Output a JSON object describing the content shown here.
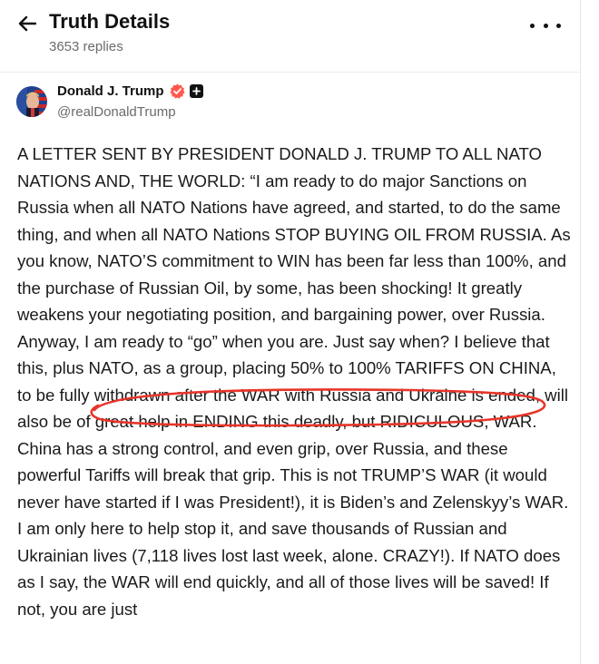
{
  "header": {
    "title": "Truth Details",
    "subtitle": "3653 replies"
  },
  "icons": {
    "back": "arrow-left-icon",
    "more": "more-horizontal-icon",
    "verified": "verified-badge-icon",
    "plus": "plus-badge-icon"
  },
  "author": {
    "name": "Donald J. Trump",
    "handle": "@realDonaldTrump"
  },
  "post": {
    "text": "A LETTER SENT BY PRESIDENT DONALD J. TRUMP TO ALL NATO NATIONS AND, THE WORLD: “I am ready to do major Sanctions on Russia when all NATO Nations have agreed, and started, to do the same thing, and when all NATO Nations STOP BUYING OIL FROM RUSSIA. As you know, NATO’S commitment to WIN has been far less than 100%, and the purchase of Russian Oil, by some, has been shocking! It greatly weakens your negotiating position, and bargaining power, over Russia. Anyway, I am ready to “go” when you are. Just say when? I believe that this, plus NATO, as a group, placing 50% to 100% TARIFFS ON CHINA, to be fully withdrawn after the WAR with Russia and Ukraine is ended, will also be of great help in ENDING this deadly, but RIDICULOUS, WAR. China has a strong control, and even grip, over Russia, and these powerful Tariffs will break that grip. This is not TRUMP’S WAR (it would never have  started if I was President!), it is Biden’s and Zelenskyy’s WAR. I am only here to help stop it, and save thousands of Russian and Ukrainian lives (7,118 lives lost last week, alone. CRAZY!). If NATO does as I say, the WAR will end quickly, and all of those lives will be saved! If not, you are just"
  },
  "colors": {
    "verified": "#ff5a4e",
    "annotation": "#e8352a"
  }
}
